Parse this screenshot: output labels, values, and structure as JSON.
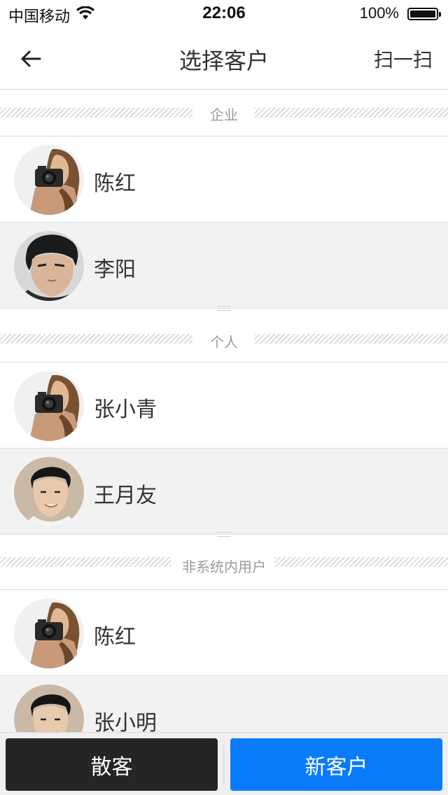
{
  "status_bar": {
    "carrier": "中国移动",
    "time": "22:06",
    "battery": "100%"
  },
  "header": {
    "title": "选择客户",
    "scan_label": "扫一扫"
  },
  "sections": [
    {
      "label": "企业",
      "items": [
        {
          "name": "陈红",
          "avatar": "photographer-avatar"
        },
        {
          "name": "李阳",
          "avatar": "man-dark-hair-avatar"
        }
      ]
    },
    {
      "label": "个人",
      "items": [
        {
          "name": "张小青",
          "avatar": "photographer-avatar"
        },
        {
          "name": "王月友",
          "avatar": "man-smiling-avatar"
        }
      ]
    },
    {
      "label": "非系统内用户",
      "items": [
        {
          "name": "陈红",
          "avatar": "photographer-avatar"
        },
        {
          "name": "张小明",
          "avatar": "man-smiling-avatar"
        }
      ]
    }
  ],
  "bottom_bar": {
    "walkin_label": "散客",
    "new_customer_label": "新客户"
  },
  "colors": {
    "primary_blue": "#0a7cfb",
    "dark_button": "#252525",
    "alt_row": "#f2f2f2"
  }
}
